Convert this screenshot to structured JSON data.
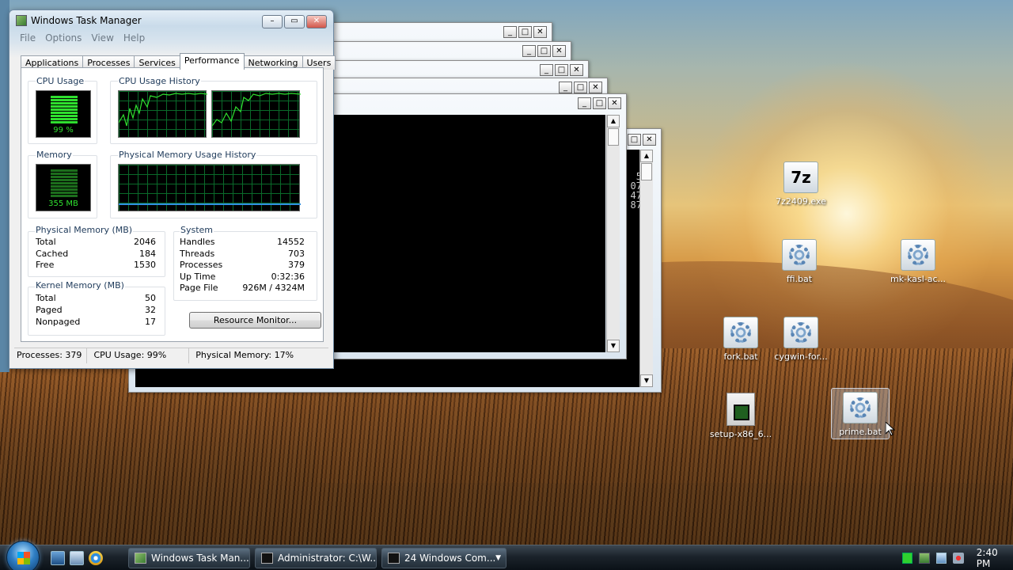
{
  "task_manager": {
    "title": "Windows Task Manager",
    "menu": [
      "File",
      "Options",
      "View",
      "Help"
    ],
    "tabs": [
      "Applications",
      "Processes",
      "Services",
      "Performance",
      "Networking",
      "Users"
    ],
    "active_tab": "Performance",
    "cpu_usage_label": "CPU Usage",
    "cpu_usage_value": "99 %",
    "cpu_history_label": "CPU Usage History",
    "memory_label": "Memory",
    "memory_value": "355 MB",
    "mem_history_label": "Physical Memory Usage History",
    "physical_memory": {
      "title": "Physical Memory (MB)",
      "rows": [
        {
          "label": "Total",
          "value": "2046"
        },
        {
          "label": "Cached",
          "value": "184"
        },
        {
          "label": "Free",
          "value": "1530"
        }
      ]
    },
    "kernel_memory": {
      "title": "Kernel Memory (MB)",
      "rows": [
        {
          "label": "Total",
          "value": "50"
        },
        {
          "label": "Paged",
          "value": "32"
        },
        {
          "label": "Nonpaged",
          "value": "17"
        }
      ]
    },
    "system": {
      "title": "System",
      "rows": [
        {
          "label": "Handles",
          "value": "14552"
        },
        {
          "label": "Threads",
          "value": "703"
        },
        {
          "label": "Processes",
          "value": "379"
        },
        {
          "label": "Up Time",
          "value": "0:32:36"
        },
        {
          "label": "Page File",
          "value": "926M / 4324M"
        }
      ]
    },
    "resource_monitor_button": "Resource Monitor...",
    "status": {
      "processes": "Processes: 379",
      "cpu": "CPU Usage: 99%",
      "memory": "Physical Memory: 17%"
    }
  },
  "console_snippet": [
    "5",
    "07",
    "47",
    "87"
  ],
  "desktop_icons": [
    {
      "label": "7z2409.exe"
    },
    {
      "label": "ffi.bat"
    },
    {
      "label": "mk-kasl-ac..."
    },
    {
      "label": "fork.bat"
    },
    {
      "label": "cygwin-for..."
    },
    {
      "label": "setup-x86_6..."
    },
    {
      "label": "prime.bat"
    }
  ],
  "taskbar": {
    "buttons": [
      {
        "label": "Windows Task Man..."
      },
      {
        "label": "Administrator: C:\\W..."
      },
      {
        "label": "24 Windows Com..."
      }
    ],
    "clock": "2:40 PM"
  },
  "colors": {
    "meter_green": "#2fe02f",
    "graph_grid": "#0a6a2a"
  }
}
